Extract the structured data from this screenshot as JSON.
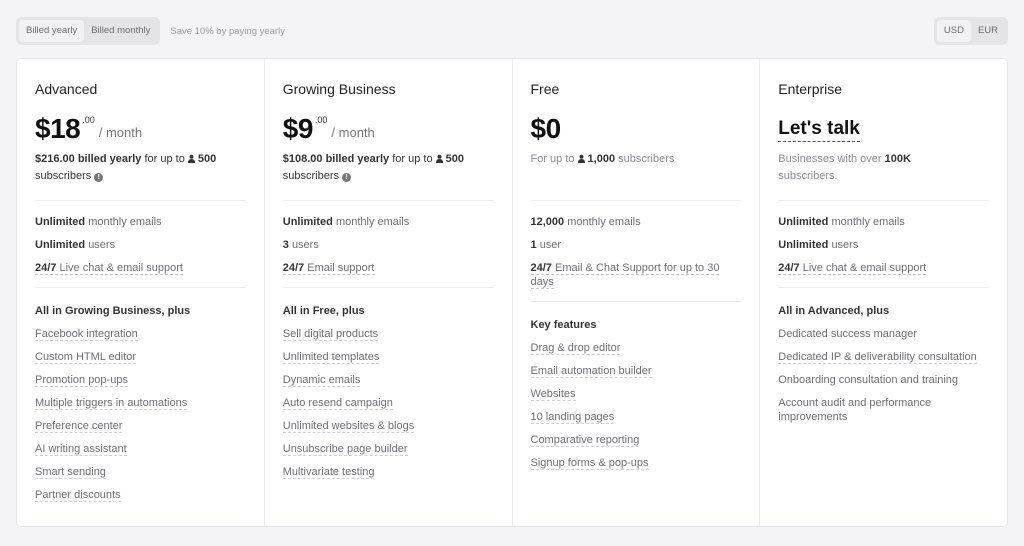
{
  "billing_toggle": {
    "options": [
      "Billed yearly",
      "Billed monthly"
    ],
    "selected": "Billed yearly",
    "save_note": "Save 10% by paying yearly"
  },
  "currency_toggle": {
    "options": [
      "USD",
      "EUR"
    ],
    "selected": "USD"
  },
  "plans": [
    {
      "name": "Advanced",
      "price": "$18",
      "cents": ".00",
      "per": "/ month",
      "billed": "$216.00 billed yearly",
      "for_up_to": "for up to",
      "subscribers_count": "500",
      "subscribers_label": "subscribers",
      "limits": [
        {
          "bold": "Unlimited",
          "text": "monthly emails"
        },
        {
          "bold": "Unlimited",
          "text": "users"
        },
        {
          "bold": "24/7",
          "text": "Live chat & email support"
        }
      ],
      "features_heading": "All in Growing Business, plus",
      "features": [
        "Facebook integration",
        "Custom HTML editor",
        "Promotion pop-ups",
        "Multiple triggers in automations",
        "Preference center",
        "AI writing assistant",
        "Smart sending",
        "Partner discounts"
      ]
    },
    {
      "name": "Growing Business",
      "price": "$9",
      "cents": ".00",
      "per": "/ month",
      "billed": "$108.00 billed yearly",
      "for_up_to": "for up to",
      "subscribers_count": "500",
      "subscribers_label": "subscribers",
      "limits": [
        {
          "bold": "Unlimited",
          "text": "monthly emails"
        },
        {
          "bold": "3",
          "text": "users"
        },
        {
          "bold": "24/7",
          "text": "Email support"
        }
      ],
      "features_heading": "All in Free, plus",
      "features": [
        "Sell digital products",
        "Unlimited templates",
        "Dynamic emails",
        "Auto resend campaign",
        "Unlimited websites & blogs",
        "Unsubscribe page builder",
        "Multivariate testing"
      ]
    },
    {
      "name": "Free",
      "price": "$0",
      "for_up_to": "For up to",
      "subscribers_count": "1,000",
      "subscribers_label": "subscribers",
      "limits": [
        {
          "bold": "12,000",
          "text": "monthly emails"
        },
        {
          "bold": "1",
          "text": "user"
        },
        {
          "bold": "24/7",
          "text": "Email & Chat Support for up to 30 days"
        }
      ],
      "features_heading": "Key features",
      "features": [
        "Drag & drop editor",
        "Email automation builder",
        "Websites",
        "10 landing pages",
        "Comparative reporting",
        "Signup forms & pop-ups"
      ]
    },
    {
      "name": "Enterprise",
      "price_cta": "Let's talk",
      "desc_prefix": "Businesses with over",
      "desc_bold": "100K",
      "desc_suffix": "subscribers.",
      "limits": [
        {
          "bold": "Unlimited",
          "text": "monthly emails"
        },
        {
          "bold": "Unlimited",
          "text": "users"
        },
        {
          "bold": "24/7",
          "text": "Live chat & email support"
        }
      ],
      "features_heading": "All in Advanced, plus",
      "features": [
        "Dedicated success manager",
        "Dedicated IP & deliverability consultation",
        "Onboarding consultation and training",
        "Account audit and performance improvements"
      ]
    }
  ]
}
